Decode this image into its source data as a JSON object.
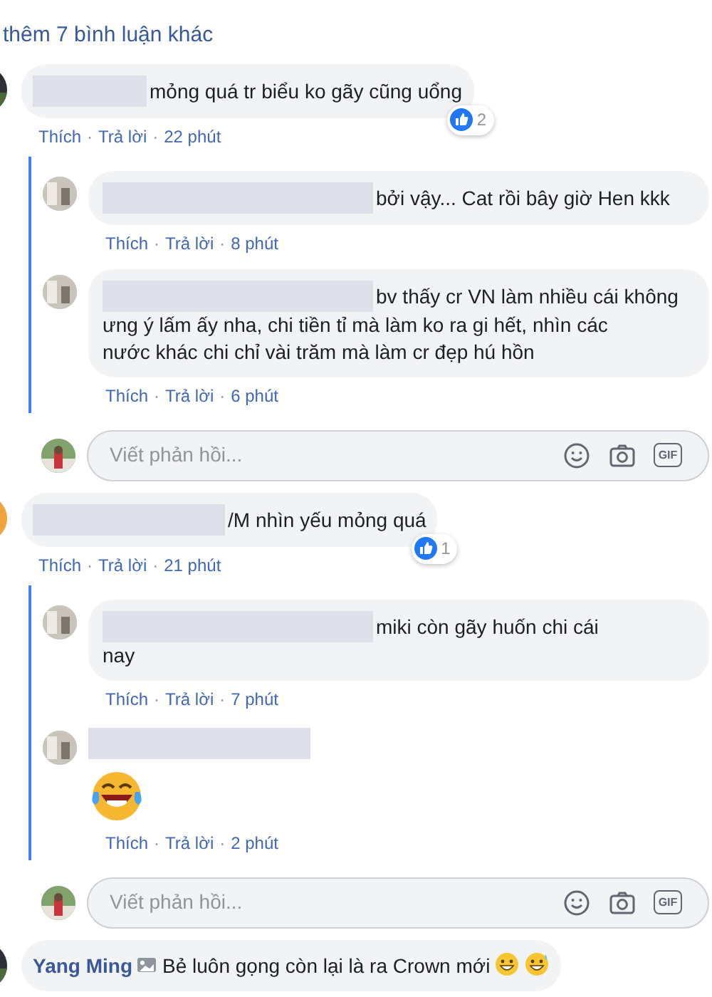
{
  "more_comments_link": "thêm 7 bình luận khác",
  "comments": [
    {
      "text_lines": [
        "mỏng quá tr biểu ko gãy cũng uổng"
      ],
      "likes": "2",
      "actions": [
        {
          "kind": "link",
          "text": "Thích"
        },
        {
          "kind": "separator",
          "text": "·"
        },
        {
          "kind": "link",
          "text": "Trả lời"
        },
        {
          "kind": "separator",
          "text": "·"
        },
        {
          "kind": "time",
          "text": "22 phút"
        }
      ],
      "replies": [
        {
          "text_lines": [
            "bởi vậy... Cat rồi bây giờ Hen kkk"
          ],
          "actions": [
            {
              "kind": "link",
              "text": "Thích"
            },
            {
              "kind": "separator",
              "text": "·"
            },
            {
              "kind": "link",
              "text": "Trả lời"
            },
            {
              "kind": "separator",
              "text": "·"
            },
            {
              "kind": "time",
              "text": "8 phút"
            }
          ]
        },
        {
          "text_lines": [
            "bv thấy cr VN làm nhiều cái không",
            "ưng ý lấm ấy nha, chi tiền tỉ mà làm ko ra gi hết, nhìn các",
            "nước khác chi chỉ vài trăm mà làm cr đẹp hú hồn"
          ],
          "actions": [
            {
              "kind": "link",
              "text": "Thích"
            },
            {
              "kind": "separator",
              "text": "·"
            },
            {
              "kind": "link",
              "text": "Trả lời"
            },
            {
              "kind": "separator",
              "text": "·"
            },
            {
              "kind": "time",
              "text": "6 phút"
            }
          ]
        }
      ],
      "reply_box": {
        "placeholder": "Viết phản hồi...",
        "gif_label": "GIF"
      }
    },
    {
      "text_lines": [
        "/M nhìn yếu mỏng quá"
      ],
      "likes": "1",
      "actions": [
        {
          "kind": "link",
          "text": "Thích"
        },
        {
          "kind": "separator",
          "text": "·"
        },
        {
          "kind": "link",
          "text": "Trả lời"
        },
        {
          "kind": "separator",
          "text": "·"
        },
        {
          "kind": "time",
          "text": "21 phút"
        }
      ],
      "replies": [
        {
          "text_lines": [
            "miki còn gãy huốn chi cái",
            "nay"
          ],
          "actions": [
            {
              "kind": "link",
              "text": "Thích"
            },
            {
              "kind": "separator",
              "text": "·"
            },
            {
              "kind": "link",
              "text": "Trả lời"
            },
            {
              "kind": "separator",
              "text": "·"
            },
            {
              "kind": "time",
              "text": "7 phút"
            }
          ]
        },
        {
          "sticker": {
            "kind": "laugh-cry"
          },
          "actions": [
            {
              "kind": "link",
              "text": "Thích"
            },
            {
              "kind": "separator",
              "text": "·"
            },
            {
              "kind": "link",
              "text": "Trả lời"
            },
            {
              "kind": "separator",
              "text": "·"
            },
            {
              "kind": "time",
              "text": "2 phút"
            }
          ]
        }
      ],
      "reply_box": {
        "placeholder": "Viết phản hồi...",
        "gif_label": "GIF"
      }
    },
    {
      "author": "Yang Ming",
      "text_lines": [
        "Bẻ luôn gọng còn lại là ra Crown mới"
      ],
      "emoji_icons": [
        {
          "kind": "grin"
        },
        {
          "kind": "sweat-grin"
        }
      ]
    }
  ]
}
